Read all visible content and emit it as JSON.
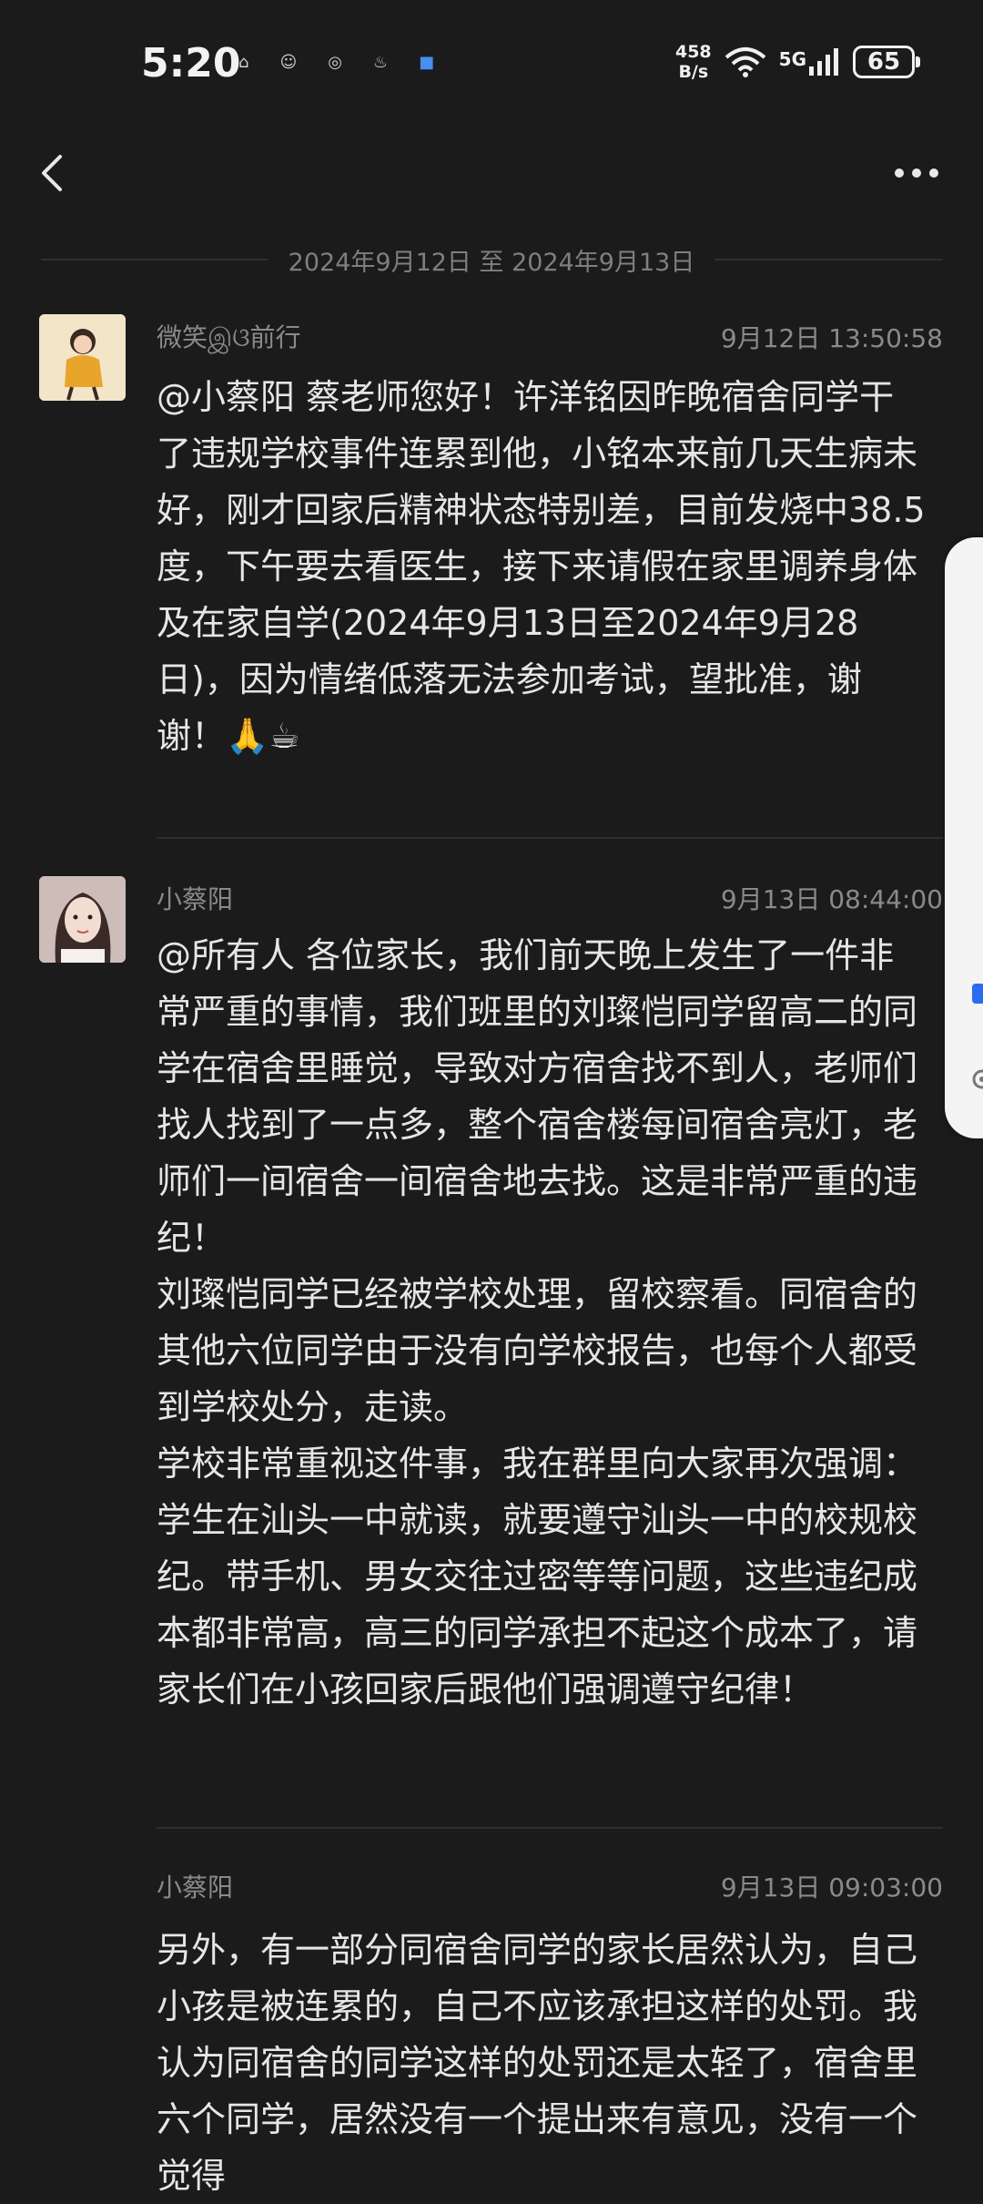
{
  "status_bar": {
    "time": "5:20",
    "net_speed_value": "458",
    "net_speed_unit": "B/s",
    "network_type": "5G",
    "battery": "65"
  },
  "nav": {
    "back_icon": "back-arrow-icon",
    "more_icon": "more-dots-icon"
  },
  "date_range": "2024年9月12日 至 2024年9月13日",
  "messages": [
    {
      "sender": "微笑இଓ前行",
      "time": "9月12日 13:50:58",
      "body": "@小蔡阳 蔡老师您好！许洋铭因昨晚宿舍同学干了违规学校事件连累到他，小铭本来前几天生病未好，刚才回家后精神状态特别差，目前发烧中38.5度，下午要去看医生，接下来请假在家里调养身体及在家自学(2024年9月13日至2024年9月28日)，因为情绪低落无法参加考试，望批准，谢谢！🙏☕"
    },
    {
      "sender": "小蔡阳",
      "time": "9月13日 08:44:00",
      "body": "@所有人 各位家长，我们前天晚上发生了一件非常严重的事情，我们班里的刘璨恺同学留高二的同学在宿舍里睡觉，导致对方宿舍找不到人，老师们找人找到了一点多，整个宿舍楼每间宿舍亮灯，老师们一间宿舍一间宿舍地去找。这是非常严重的违纪！\n刘璨恺同学已经被学校处理，留校察看。同宿舍的其他六位同学由于没有向学校报告，也每个人都受到学校处分，走读。\n学校非常重视这件事，我在群里向大家再次强调：学生在汕头一中就读，就要遵守汕头一中的校规校纪。带手机、男女交往过密等等问题，这些违纪成本都非常高，高三的同学承担不起这个成本了，请家长们在小孩回家后跟他们强调遵守纪律！"
    },
    {
      "sender": "小蔡阳",
      "time": "9月13日 09:03:00",
      "body": "另外，有一部分同宿舍同学的家长居然认为，自己小孩是被连累的，自己不应该承担这样的处罚。我认为同宿舍的同学这样的处罚还是太轻了，宿舍里六个同学，居然没有一个提出来有意见，没有一个觉得"
    }
  ]
}
